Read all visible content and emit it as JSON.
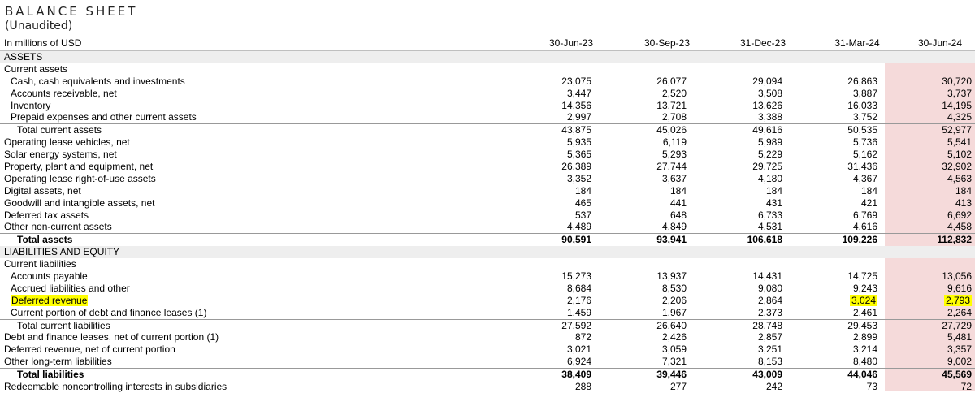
{
  "title": "BALANCE SHEET",
  "subtitle": "(Unaudited)",
  "header": {
    "unit_label": "In millions of USD",
    "periods": [
      "30-Jun-23",
      "30-Sep-23",
      "31-Dec-23",
      "31-Mar-24",
      "30-Jun-24"
    ]
  },
  "highlight_column_color": "#f5dada",
  "highlight_cell_color": "#ffff00",
  "rows": [
    {
      "label": "ASSETS",
      "values": [
        "",
        "",
        "",
        "",
        ""
      ]
    },
    {
      "label": "Current assets",
      "values": [
        "",
        "",
        "",
        "",
        ""
      ]
    },
    {
      "label": "Cash, cash equivalents and investments",
      "values": [
        "23,075",
        "26,077",
        "29,094",
        "26,863",
        "30,720"
      ]
    },
    {
      "label": "Accounts receivable, net",
      "values": [
        "3,447",
        "2,520",
        "3,508",
        "3,887",
        "3,737"
      ]
    },
    {
      "label": "Inventory",
      "values": [
        "14,356",
        "13,721",
        "13,626",
        "16,033",
        "14,195"
      ]
    },
    {
      "label": "Prepaid expenses and other current assets",
      "values": [
        "2,997",
        "2,708",
        "3,388",
        "3,752",
        "4,325"
      ]
    },
    {
      "label": "Total current assets",
      "values": [
        "43,875",
        "45,026",
        "49,616",
        "50,535",
        "52,977"
      ]
    },
    {
      "label": "Operating lease vehicles, net",
      "values": [
        "5,935",
        "6,119",
        "5,989",
        "5,736",
        "5,541"
      ]
    },
    {
      "label": "Solar energy systems, net",
      "values": [
        "5,365",
        "5,293",
        "5,229",
        "5,162",
        "5,102"
      ]
    },
    {
      "label": "Property, plant and equipment, net",
      "values": [
        "26,389",
        "27,744",
        "29,725",
        "31,436",
        "32,902"
      ]
    },
    {
      "label": "Operating lease right-of-use assets",
      "values": [
        "3,352",
        "3,637",
        "4,180",
        "4,367",
        "4,563"
      ]
    },
    {
      "label": "Digital assets, net",
      "values": [
        "184",
        "184",
        "184",
        "184",
        "184"
      ]
    },
    {
      "label": "Goodwill and intangible assets, net",
      "values": [
        "465",
        "441",
        "431",
        "421",
        "413"
      ]
    },
    {
      "label": "Deferred tax assets",
      "values": [
        "537",
        "648",
        "6,733",
        "6,769",
        "6,692"
      ]
    },
    {
      "label": "Other non-current assets",
      "values": [
        "4,489",
        "4,849",
        "4,531",
        "4,616",
        "4,458"
      ]
    },
    {
      "label": "Total assets",
      "values": [
        "90,591",
        "93,941",
        "106,618",
        "109,226",
        "112,832"
      ]
    },
    {
      "label": "LIABILITIES AND EQUITY",
      "values": [
        "",
        "",
        "",
        "",
        ""
      ]
    },
    {
      "label": "Current liabilities",
      "values": [
        "",
        "",
        "",
        "",
        ""
      ]
    },
    {
      "label": "Accounts payable",
      "values": [
        "15,273",
        "13,937",
        "14,431",
        "14,725",
        "13,056"
      ]
    },
    {
      "label": "Accrued liabilities and other",
      "values": [
        "8,684",
        "8,530",
        "9,080",
        "9,243",
        "9,616"
      ]
    },
    {
      "label": "Deferred revenue",
      "values": [
        "2,176",
        "2,206",
        "2,864",
        "3,024",
        "2,793"
      ]
    },
    {
      "label": "Current portion of debt and finance leases (1)",
      "values": [
        "1,459",
        "1,967",
        "2,373",
        "2,461",
        "2,264"
      ]
    },
    {
      "label": "Total current liabilities",
      "values": [
        "27,592",
        "26,640",
        "28,748",
        "29,453",
        "27,729"
      ]
    },
    {
      "label": "Debt and finance leases, net of current portion (1)",
      "values": [
        "872",
        "2,426",
        "2,857",
        "2,899",
        "5,481"
      ]
    },
    {
      "label": "Deferred revenue, net of current portion",
      "values": [
        "3,021",
        "3,059",
        "3,251",
        "3,214",
        "3,357"
      ]
    },
    {
      "label": "Other long-term liabilities",
      "values": [
        "6,924",
        "7,321",
        "8,153",
        "8,480",
        "9,002"
      ]
    },
    {
      "label": "Total liabilities",
      "values": [
        "38,409",
        "39,446",
        "43,009",
        "44,046",
        "45,569"
      ]
    },
    {
      "label": "Redeemable noncontrolling interests in subsidiaries",
      "values": [
        "288",
        "277",
        "242",
        "73",
        "72"
      ]
    }
  ]
}
